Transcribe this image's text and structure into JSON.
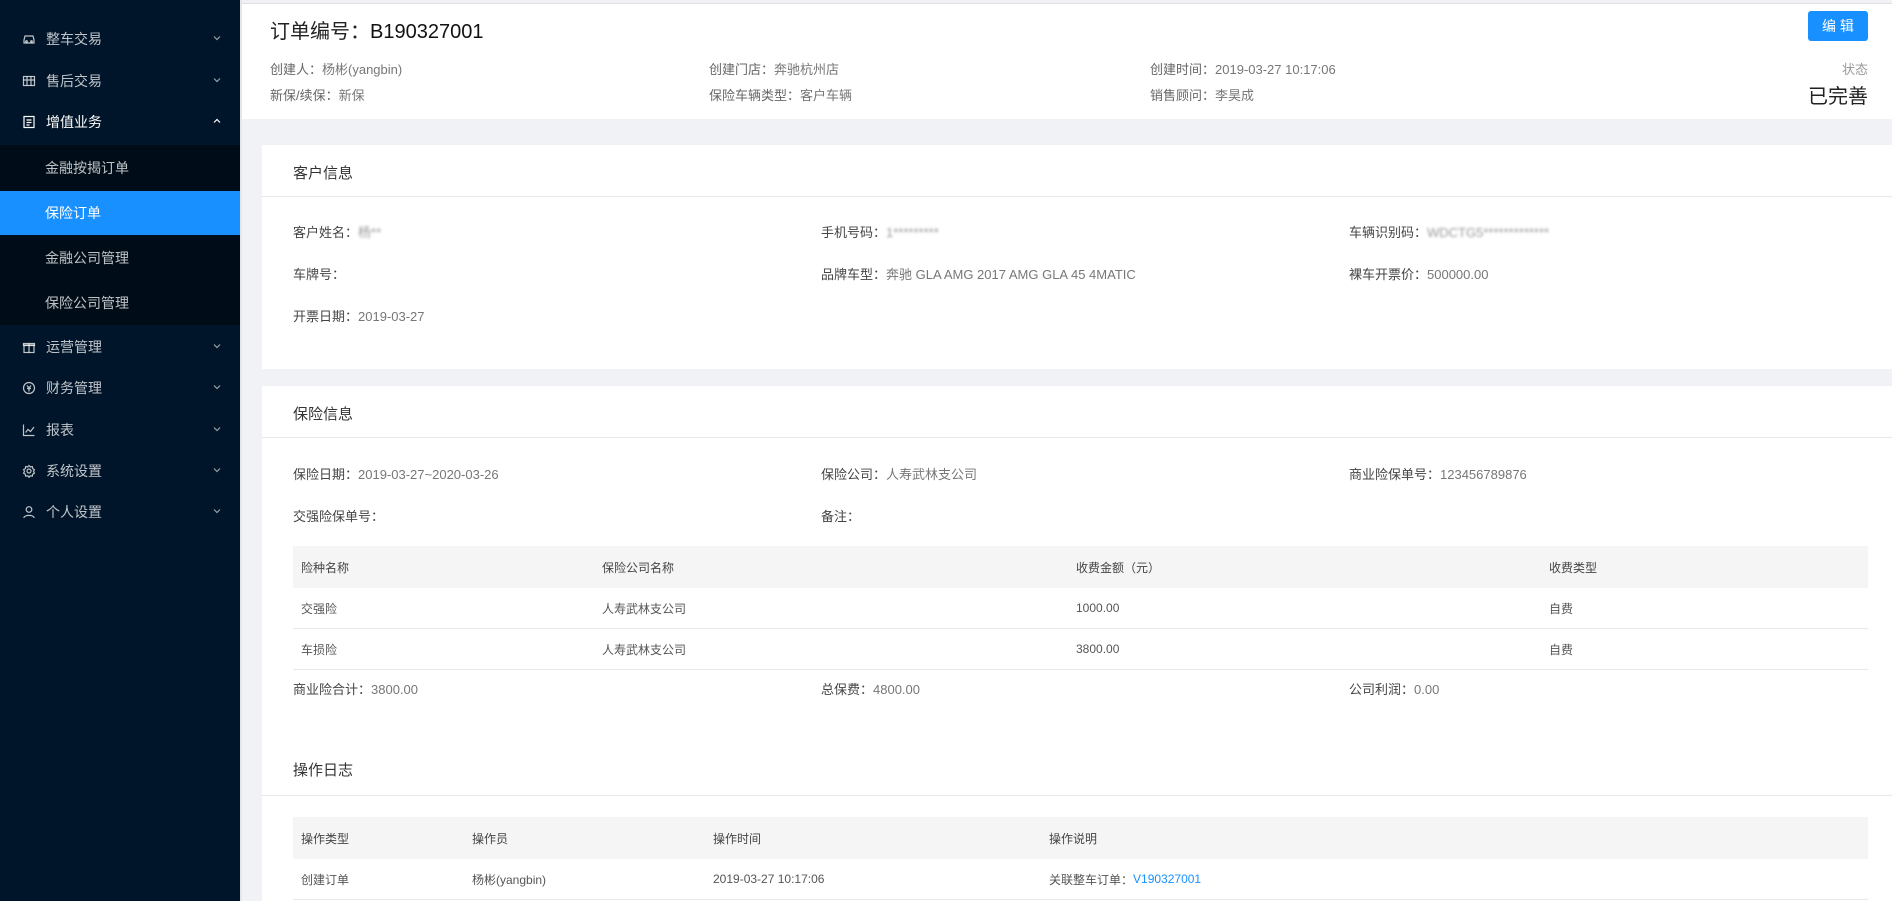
{
  "sidebar": {
    "items": [
      {
        "label": "整车交易",
        "icon": "car-icon"
      },
      {
        "label": "售后交易",
        "icon": "table-icon"
      },
      {
        "label": "增值业务",
        "icon": "file-icon"
      },
      {
        "label": "运营管理",
        "icon": "gift-icon"
      },
      {
        "label": "财务管理",
        "icon": "money-icon"
      },
      {
        "label": "报表",
        "icon": "chart-icon"
      },
      {
        "label": "系统设置",
        "icon": "settings-icon"
      },
      {
        "label": "个人设置",
        "icon": "user-icon"
      }
    ],
    "sub_items": [
      {
        "label": "金融按揭订单"
      },
      {
        "label": "保险订单"
      },
      {
        "label": "金融公司管理"
      },
      {
        "label": "保险公司管理"
      }
    ],
    "active_sub": "保险订单"
  },
  "header": {
    "order_no_label": "订单编号：",
    "order_no": "B190327001",
    "edit_button": "编 辑",
    "creator_label": "创建人：",
    "creator": "杨彬(yangbin)",
    "store_label": "创建门店：",
    "store": "奔驰杭州店",
    "created_label": "创建时间：",
    "created": "2019-03-27 10:17:06",
    "new_renew_label": "新保/续保：",
    "new_renew": "新保",
    "vehicle_type_label": "保险车辆类型：",
    "vehicle_type": "客户车辆",
    "consultant_label": "销售顾问：",
    "consultant": "李昊成",
    "status_label": "状态",
    "status": "已完善"
  },
  "customer": {
    "title": "客户信息",
    "name_label": "客户姓名：",
    "name": "杨**",
    "phone_label": "手机号码：",
    "phone": "1*********",
    "vin_label": "车辆识别码：",
    "vin": "WDCTG5*************",
    "plate_label": "车牌号：",
    "plate": "",
    "model_label": "品牌车型：",
    "model": "奔驰 GLA AMG 2017 AMG GLA 45 4MATIC",
    "price_label": "裸车开票价：",
    "price": "500000.00",
    "invoice_date_label": "开票日期：",
    "invoice_date": "2019-03-27"
  },
  "insurance": {
    "title": "保险信息",
    "date_label": "保险日期：",
    "date": "2019-03-27~2020-03-26",
    "company_label": "保险公司：",
    "company": "人寿武林支公司",
    "commercial_no_label": "商业险保单号：",
    "commercial_no": "123456789876",
    "compulsory_no_label": "交强险保单号：",
    "compulsory_no": "",
    "remark_label": "备注：",
    "remark": "",
    "table": {
      "headers": [
        "险种名称",
        "保险公司名称",
        "收费金额（元）",
        "收费类型"
      ],
      "rows": [
        [
          "交强险",
          "人寿武林支公司",
          "1000.00",
          "自费"
        ],
        [
          "车损险",
          "人寿武林支公司",
          "3800.00",
          "自费"
        ]
      ]
    },
    "commercial_total_label": "商业险合计：",
    "commercial_total": "3800.00",
    "total_premium_label": "总保费：",
    "total_premium": "4800.00",
    "profit_label": "公司利润：",
    "profit": "0.00"
  },
  "log": {
    "title": "操作日志",
    "headers": [
      "操作类型",
      "操作员",
      "操作时间",
      "操作说明"
    ],
    "rows": [
      {
        "type": "创建订单",
        "operator": "杨彬(yangbin)",
        "time": "2019-03-27 10:17:06",
        "desc_prefix": "关联整车订单：",
        "link": "V190327001"
      }
    ]
  },
  "colors": {
    "sidebar_bg": "#001529",
    "accent": "#1890ff"
  }
}
